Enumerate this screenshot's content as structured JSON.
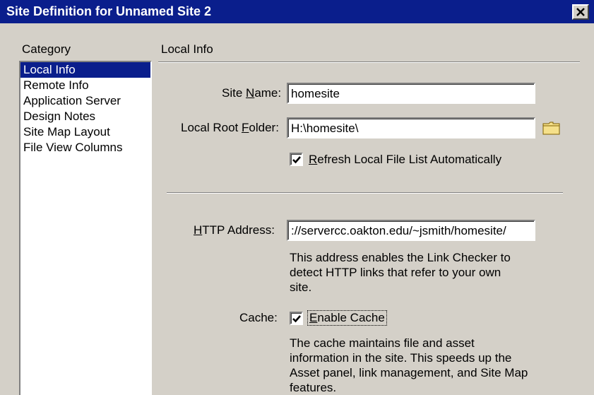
{
  "window": {
    "title": "Site Definition for Unnamed Site 2"
  },
  "sidebar": {
    "header": "Category",
    "items": [
      {
        "label": "Local Info",
        "selected": true
      },
      {
        "label": "Remote Info"
      },
      {
        "label": "Application Server"
      },
      {
        "label": "Design Notes"
      },
      {
        "label": "Site Map Layout"
      },
      {
        "label": "File View Columns"
      }
    ]
  },
  "panel": {
    "header": "Local Info",
    "site_name": {
      "label_pre": "Site ",
      "label_key": "N",
      "label_post": "ame:",
      "value": "homesite"
    },
    "local_root": {
      "label_pre": "Local Root ",
      "label_key": "F",
      "label_post": "older:",
      "value": "H:\\homesite\\"
    },
    "refresh": {
      "label_key": "R",
      "label_post": "efresh Local File List Automatically",
      "checked": true
    },
    "http": {
      "label_key": "H",
      "label_post": "TTP Address:",
      "value": "://servercc.oakton.edu/~jsmith/homesite/"
    },
    "http_desc": "This address enables the Link Checker to\ndetect HTTP links that refer to your own\nsite.",
    "cache": {
      "label": "Cache:",
      "option_key": "E",
      "option_post": "nable Cache",
      "checked": true
    },
    "cache_desc": "The cache maintains file and asset\ninformation in the site.  This speeds up the\nAsset panel, link management, and Site Map\nfeatures."
  },
  "icons": {
    "folder": "folder-icon",
    "close": "close-icon",
    "check": "checkmark-icon"
  },
  "colors": {
    "titlebar": "#0a1e8c",
    "selection": "#0a1e8c",
    "dialog": "#d4d0c8",
    "folder": "#f5e08a"
  }
}
